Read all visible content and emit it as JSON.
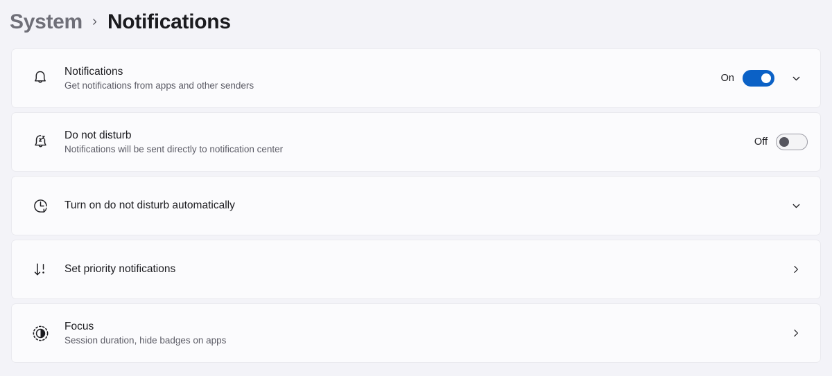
{
  "breadcrumb": {
    "parent": "System",
    "separator": "›",
    "current": "Notifications"
  },
  "colors": {
    "page_background": "#f3f3f8",
    "card_background": "#fbfbfd",
    "card_border": "#eaeaef",
    "accent_toggle_on": "#0b61c6",
    "title_text": "#1b1b1f",
    "subtitle_text": "#5c5c66",
    "breadcrumb_parent_text": "#6f6f78"
  },
  "settings": [
    {
      "icon": "bell-icon",
      "title": "Notifications",
      "subtitle": "Get notifications from apps and other senders",
      "state_label": "On",
      "toggle_state": "on",
      "trailing_icon": "chevron-down-icon"
    },
    {
      "icon": "bell-sleep-icon",
      "title": "Do not disturb",
      "subtitle": "Notifications will be sent directly to notification center",
      "state_label": "Off",
      "toggle_state": "off",
      "trailing_icon": ""
    },
    {
      "icon": "clock-auto-icon",
      "title": "Turn on do not disturb automatically",
      "subtitle": "",
      "state_label": "",
      "toggle_state": "",
      "trailing_icon": "chevron-down-icon"
    },
    {
      "icon": "priority-sort-icon",
      "title": "Set priority notifications",
      "subtitle": "",
      "state_label": "",
      "toggle_state": "",
      "trailing_icon": "chevron-right-icon"
    },
    {
      "icon": "focus-session-icon",
      "title": "Focus",
      "subtitle": "Session duration, hide badges on apps",
      "state_label": "",
      "toggle_state": "",
      "trailing_icon": "chevron-right-icon"
    }
  ]
}
